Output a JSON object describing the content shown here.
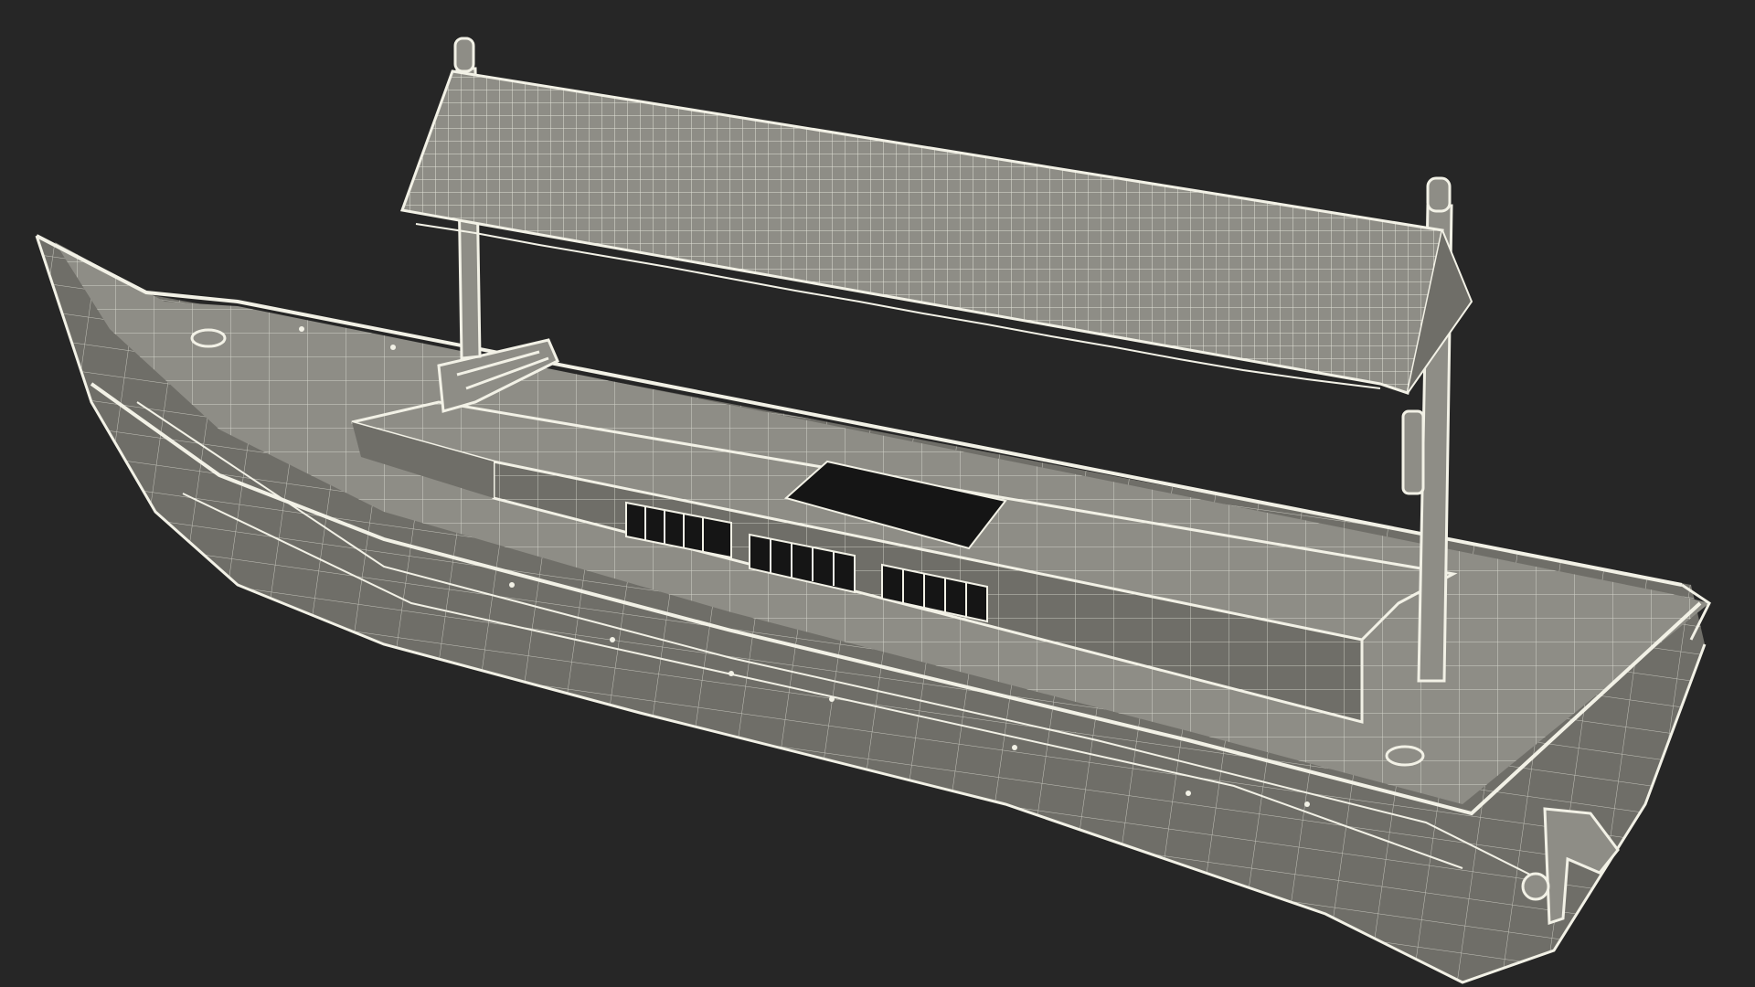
{
  "scene": {
    "subject": "boat-wireframe",
    "background_color": "#262626",
    "surface_color": "#8e8d86",
    "surface_shade_color": "#6f6e68",
    "wire_color": "#f2f1e6",
    "window_color": "#151515"
  }
}
